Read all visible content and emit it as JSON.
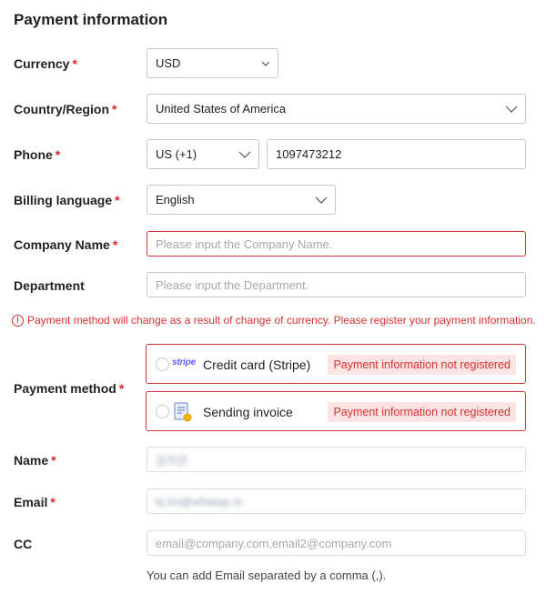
{
  "section_title": "Payment information",
  "required_mark": "*",
  "currency": {
    "label": "Currency",
    "value": "USD"
  },
  "country": {
    "label": "Country/Region",
    "value": "United States of America"
  },
  "phone": {
    "label": "Phone",
    "code": "US (+1)",
    "number": "1097473212"
  },
  "billing_language": {
    "label": "Billing language",
    "value": "English"
  },
  "company_name": {
    "label": "Company Name",
    "placeholder": "Please input the Company Name."
  },
  "department": {
    "label": "Department",
    "placeholder": "Please input the Department."
  },
  "notice": {
    "icon": "!",
    "text": "Payment method will change as a result of change of currency. Please register your payment information."
  },
  "payment_method": {
    "label": "Payment method",
    "options": [
      {
        "logo": "stripe",
        "label": "Credit card (Stripe)",
        "status": "Payment information not registered",
        "icon": "stripe-logo-icon"
      },
      {
        "label": "Sending invoice",
        "status": "Payment information not registered",
        "icon": "invoice-document-icon"
      }
    ]
  },
  "name": {
    "label": "Name",
    "value": "김지은"
  },
  "email": {
    "label": "Email",
    "value": "kj.im@whatap.io"
  },
  "cc": {
    "label": "CC",
    "placeholder": "email@company.com,email2@company.com",
    "hint": "You can add Email separated by a comma (,)."
  },
  "colors": {
    "error": "#d93030",
    "badge_bg": "#fde4e4",
    "stripe": "#635bff",
    "border": "#c7c7c7"
  }
}
